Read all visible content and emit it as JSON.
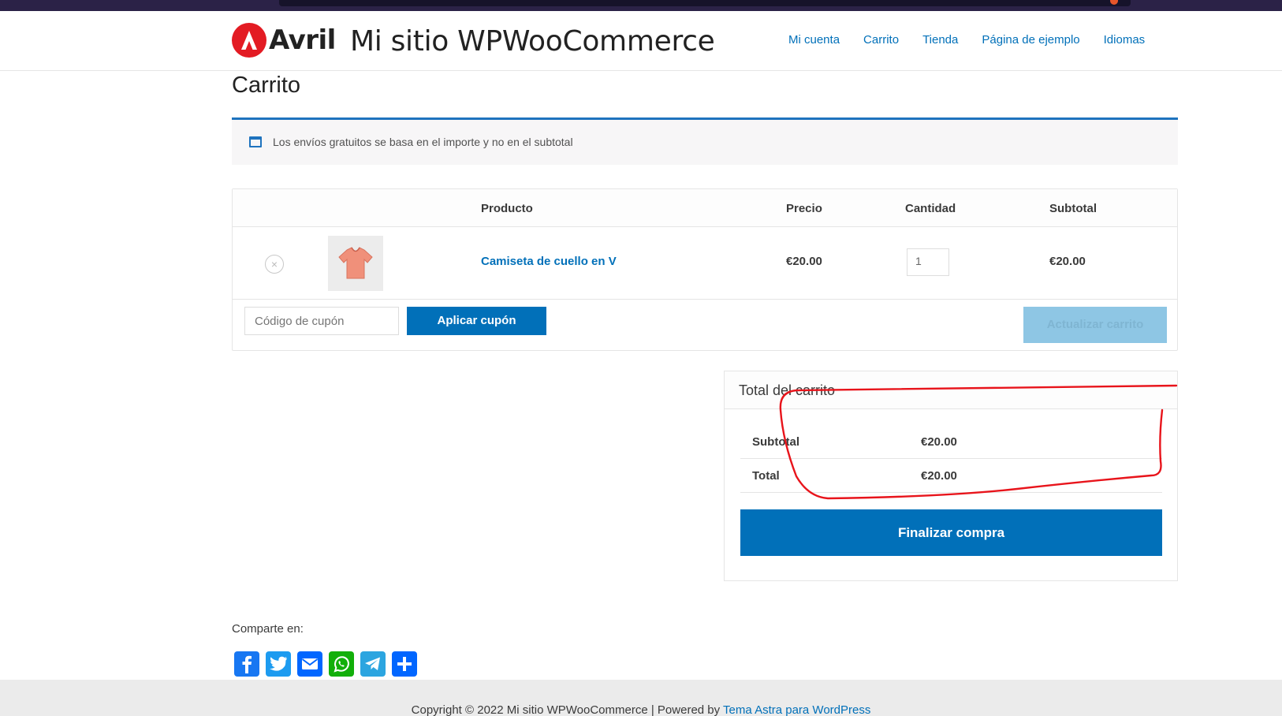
{
  "site": {
    "logo_text": "Avril",
    "title": "Mi sitio WPWooCommerce"
  },
  "nav": {
    "items": [
      "Mi cuenta",
      "Carrito",
      "Tienda",
      "Página de ejemplo",
      "Idiomas"
    ]
  },
  "page": {
    "title": "Carrito"
  },
  "notice": {
    "text": "Los envíos gratuitos se basa en el importe y no en el subtotal",
    "icon": "window-icon"
  },
  "cart": {
    "headers": {
      "product": "Producto",
      "price": "Precio",
      "quantity": "Cantidad",
      "subtotal": "Subtotal"
    },
    "items": [
      {
        "name": "Camiseta de cuello en V",
        "price": "€20.00",
        "quantity": "1",
        "subtotal": "€20.00"
      }
    ],
    "coupon_placeholder": "Código de cupón",
    "apply_coupon": "Aplicar cupón",
    "update_cart": "Actualizar carrito"
  },
  "totals": {
    "title": "Total del carrito",
    "subtotal_label": "Subtotal",
    "subtotal_value": "€20.00",
    "total_label": "Total",
    "total_value": "€20.00",
    "checkout": "Finalizar compra"
  },
  "share": {
    "label": "Comparte en:",
    "services": [
      "facebook-icon",
      "twitter-icon",
      "email-icon",
      "whatsapp-icon",
      "telegram-icon",
      "share-plus-icon"
    ]
  },
  "footer": {
    "copyright": "Copyright © 2022 Mi sitio WPWooCommerce | Powered by ",
    "theme_link": "Tema Astra para WordPress"
  },
  "colors": {
    "accent": "#0170b9",
    "annotation": "#e8141b"
  }
}
